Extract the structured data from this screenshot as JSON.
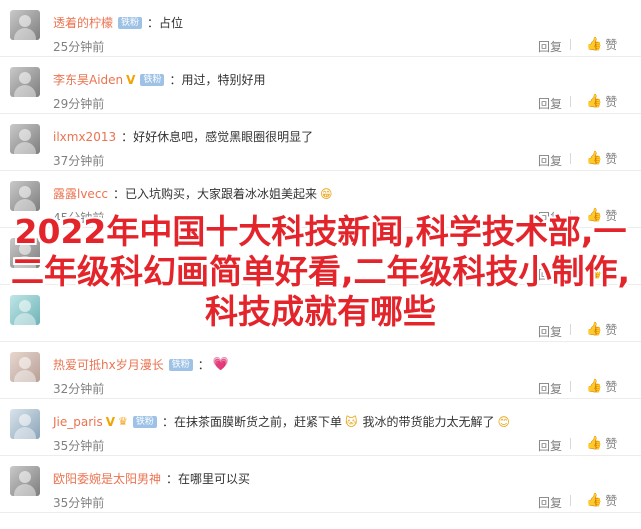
{
  "comments": [
    {
      "user": "透着的柠檬",
      "v": "",
      "badge": "铁粉",
      "text": "占位",
      "emoji": "",
      "time": "25分钟前",
      "reply": "回复",
      "like": "赞"
    },
    {
      "user": "李东昊Aiden",
      "v": "V",
      "badge": "铁粉",
      "text": "用过，特别好用",
      "emoji": "",
      "time": "29分钟前",
      "reply": "回复",
      "like": "赞"
    },
    {
      "user": "ilxmx2013",
      "v": "",
      "badge": "",
      "text": "好好休息吧，感觉黑眼圈很明显了",
      "emoji": "",
      "time": "37分钟前",
      "reply": "回复",
      "like": "赞"
    },
    {
      "user": "露露lvecc",
      "v": "",
      "badge": "",
      "text": "已入坑购买，大家跟着冰冰姐美起来",
      "emoji": "😁",
      "time": "45分钟前",
      "reply": "回复",
      "like": "赞"
    },
    {
      "user": "",
      "v": "",
      "badge": "",
      "text": "",
      "emoji": "",
      "time": "",
      "reply": "回复",
      "like": "赞"
    },
    {
      "user": "",
      "v": "",
      "badge": "",
      "text": "",
      "emoji": "",
      "time": "",
      "reply": "回复",
      "like": "赞"
    },
    {
      "user": "热爱可抵hx岁月漫长",
      "v": "",
      "badge": "铁粉",
      "text": "",
      "emoji": "💗",
      "time": "32分钟前",
      "reply": "回复",
      "like": "赞"
    },
    {
      "user": "Jie_paris",
      "v": "V",
      "badge": "铁粉",
      "text": "在抹茶面膜断货之前，赶紧下单",
      "text2": "我冰的带货能力太无解了",
      "emoji": "🐱",
      "emoji2": "😊",
      "time": "35分钟前",
      "reply": "回复",
      "like": "赞"
    },
    {
      "user": "欧阳委婉是太阳男神",
      "v": "",
      "badge": "",
      "text": "在哪里可以买",
      "emoji": "",
      "time": "35分钟前",
      "reply": "回复",
      "like": "赞"
    }
  ],
  "overlay_title": "2022年中国十大科技新闻,科学技术部,一二年级科幻画简单好看,二年级科技小制作,科技成就有哪些"
}
